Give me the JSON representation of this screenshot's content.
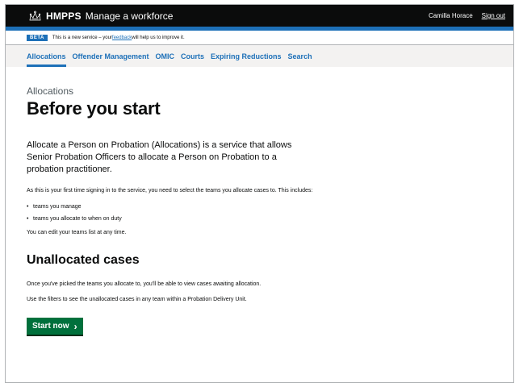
{
  "header": {
    "brand": "HMPPS",
    "service_name": "Manage a workforce",
    "username": "Camilla Horace",
    "signout_label": "Sign out"
  },
  "phase_banner": {
    "tag": "BETA",
    "text_before": "This is a new service – your ",
    "link_text": "feedback",
    "text_after": " will help us to improve it."
  },
  "nav": {
    "items": [
      {
        "label": "Allocations",
        "active": true
      },
      {
        "label": "Offender Management",
        "active": false
      },
      {
        "label": "OMIC",
        "active": false
      },
      {
        "label": "Courts",
        "active": false
      },
      {
        "label": "Expiring Reductions",
        "active": false
      },
      {
        "label": "Search",
        "active": false
      }
    ]
  },
  "main": {
    "caption": "Allocations",
    "title": "Before you start",
    "lead": "Allocate a Person on Probation (Allocations) is a service that allows Senior Probation Officers to allocate a Person on Probation to a probation practitioner.",
    "intro": "As this is your first time signing in to the service, you need to select the teams you allocate cases to. This includes:",
    "list": [
      "teams you manage",
      "teams you allocate to when on duty"
    ],
    "edit_note": "You can edit your teams list at any time.",
    "section_title": "Unallocated cases",
    "para1": "Once you've picked the teams you allocate to, you'll be able to view cases awaiting allocation.",
    "para2": "Use the filters to see the unallocated cases in any team within a Probation Delivery Unit.",
    "start_button": "Start now"
  },
  "colors": {
    "header_bg": "#0b0c0c",
    "brand_blue": "#1d70b8",
    "button_green": "#00703c",
    "nav_bg": "#f3f2f1"
  },
  "icons": {
    "crown": "crown-icon",
    "start_chevron": "chevron-right-icon"
  }
}
